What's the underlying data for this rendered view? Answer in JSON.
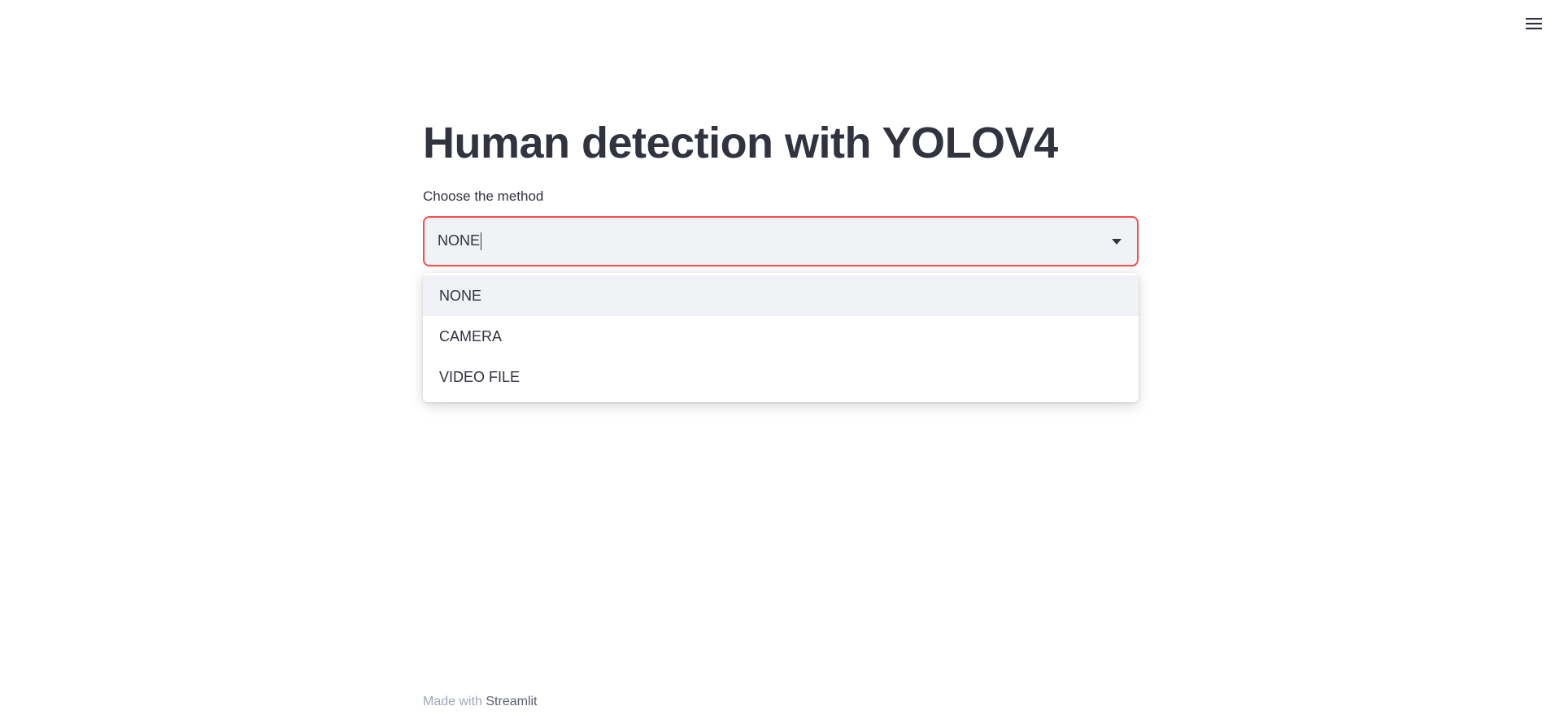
{
  "header": {
    "menu_icon": "hamburger-menu-icon"
  },
  "main": {
    "title": "Human detection with YOLOV4",
    "select": {
      "label": "Choose the method",
      "value": "NONE",
      "arrow_icon": "caret-down-icon",
      "focus_color": "#ff4b4b",
      "options": [
        {
          "label": "NONE",
          "highlighted": true
        },
        {
          "label": "CAMERA",
          "highlighted": false
        },
        {
          "label": "VIDEO FILE",
          "highlighted": false
        }
      ]
    }
  },
  "footer": {
    "prefix": "Made with ",
    "link": "Streamlit"
  },
  "colors": {
    "text": "#31333f",
    "input_bg": "#f0f2f6",
    "accent": "#ff4b4b",
    "muted": "#a3a8b8"
  }
}
